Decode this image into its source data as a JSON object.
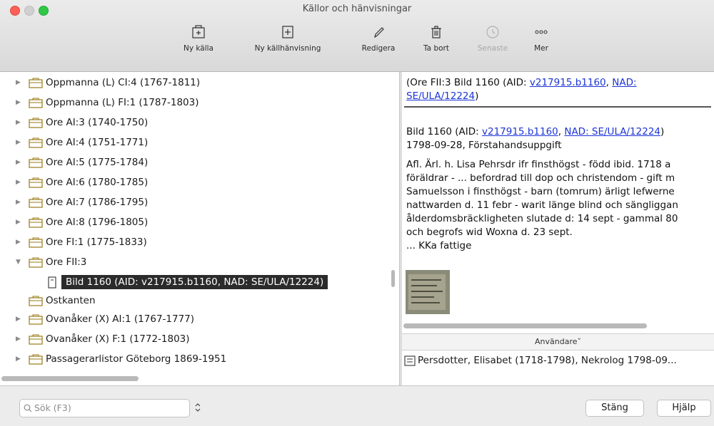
{
  "window": {
    "title": "Källor och hänvisningar"
  },
  "toolbar": [
    {
      "label": "Ny källa",
      "icon": "new-source-icon",
      "enabled": true
    },
    {
      "label": "Ny källhänvisning",
      "icon": "new-citation-icon",
      "enabled": true
    },
    {
      "label": "Redigera",
      "icon": "pencil-icon",
      "enabled": true
    },
    {
      "label": "Ta bort",
      "icon": "trash-icon",
      "enabled": true
    },
    {
      "label": "Senaste",
      "icon": "recent-icon",
      "enabled": false
    },
    {
      "label": "Mer",
      "icon": "more-dots-icon",
      "enabled": true
    }
  ],
  "tree": [
    {
      "label": "Oppmanna (L) CI:4 (1767-1811)"
    },
    {
      "label": "Oppmanna (L) FI:1 (1787-1803)"
    },
    {
      "label": "Ore AI:3 (1740-1750)"
    },
    {
      "label": "Ore AI:4 (1751-1771)"
    },
    {
      "label": "Ore AI:5 (1775-1784)"
    },
    {
      "label": "Ore AI:6 (1780-1785)"
    },
    {
      "label": "Ore AI:7 (1786-1795)"
    },
    {
      "label": "Ore AI:8 (1796-1805)"
    },
    {
      "label": "Ore FI:1 (1775-1833)"
    },
    {
      "label": "Ore FII:3"
    },
    {
      "label": "Bild 1160 (AID: v217915.b1160, NAD: SE/ULA/12224)"
    },
    {
      "label": "Ostkanten"
    },
    {
      "label": "Ovanåker (X) AI:1 (1767-1777)"
    },
    {
      "label": "Ovanåker (X) F:1 (1772-1803)"
    },
    {
      "label": "Passagerarlistor Göteborg 1869-1951"
    }
  ],
  "detail": {
    "header_prefix": "(Ore FII:3 Bild 1160 (AID: ",
    "header_link1": "v217915.b1160",
    "header_sep": ", ",
    "header_link2a": "NAD:",
    "header_link2b": "SE/ULA/12224",
    "header_suffix": ")",
    "cite_prefix": "Bild 1160 (AID: ",
    "cite_link1": "v217915.b1160",
    "cite_sep": ", ",
    "cite_link2": "NAD: SE/ULA/12224",
    "cite_suffix": ")",
    "date_line": "1798-09-28, Förstahandsuppgift",
    "body_lines": [
      "Afl. Ärl. h. Lisa Pehrsdr ifr finsthögst - född ibid. 1718 a",
      "föräldrar - ... befordrad till dop och christendom - gift m",
      "Samuelsson i finsthögst - barn (tomrum) ärligt lefwerne",
      "nattwarden d. 11 febr - warit länge blind och sängliggan",
      "ålderdomsbräckligheten slutade d: 14 sept - gammal 80",
      "och begrofs wid Woxna d. 23 sept.",
      "... KKa fattige"
    ]
  },
  "users": {
    "header": "Användare",
    "header_chevron": "˅",
    "rows": [
      {
        "label": "Persdotter, Elisabet (1718-1798), Nekrolog 1798-09..."
      }
    ]
  },
  "bottom": {
    "search_placeholder": "Sök (F3)",
    "close_label": "Stäng",
    "help_label": "Hjälp"
  }
}
